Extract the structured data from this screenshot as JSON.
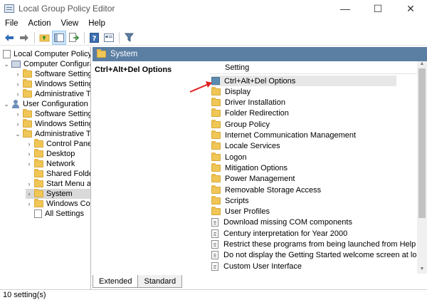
{
  "window": {
    "title": "Local Group Policy Editor",
    "controls": [
      "—",
      "☐",
      "✕"
    ]
  },
  "menu": [
    "File",
    "Action",
    "View",
    "Help"
  ],
  "toolbar": {
    "icons": [
      "back-icon",
      "forward-icon",
      "up-folder-icon",
      "show-hide-tree-icon",
      "export-list-icon",
      "help-icon",
      "properties-icon",
      "filter-icon"
    ]
  },
  "tree": {
    "root": "Local Computer Policy",
    "computer_configuration": "Computer Configura",
    "cc_software_settings": "Software Settings",
    "cc_windows_settings": "Windows Setting",
    "cc_admin_templates": "Administrative Te",
    "user_configuration": "User Configuration",
    "uc_software_settings": "Software Settings",
    "uc_windows_settings": "Windows Setting",
    "uc_admin_templates": "Administrative Te",
    "control_panel": "Control Panel",
    "desktop": "Desktop",
    "network": "Network",
    "shared_folders": "Shared Folder",
    "start_menu": "Start Menu ar",
    "system": "System",
    "windows_components": "Windows Cor",
    "all_settings": "All Settings"
  },
  "right": {
    "header": "System",
    "extended_title": "Ctrl+Alt+Del Options",
    "column_setting": "Setting",
    "items": [
      "Ctrl+Alt+Del Options",
      "Display",
      "Driver Installation",
      "Folder Redirection",
      "Group Policy",
      "Internet Communication Management",
      "Locale Services",
      "Logon",
      "Mitigation Options",
      "Power Management",
      "Removable Storage Access",
      "Scripts",
      "User Profiles",
      "Download missing COM components",
      "Century interpretation for Year 2000",
      "Restrict these programs from being launched from Help",
      "Do not display the Getting Started welcome screen at logon",
      "Custom User Interface"
    ],
    "tabs": [
      "Extended",
      "Standard"
    ]
  },
  "status": "10 setting(s)",
  "colors": {
    "header_bar": "#5b7ea3",
    "folder": "#f0c756",
    "annotation_arrow": "#e02020"
  }
}
